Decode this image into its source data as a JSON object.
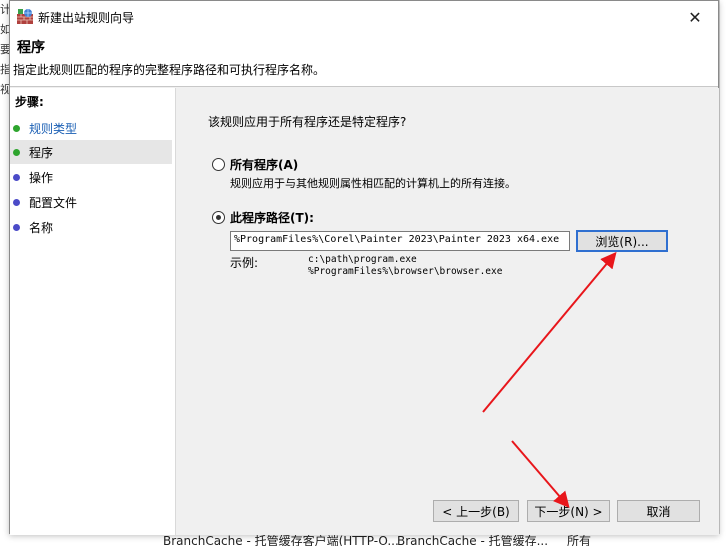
{
  "background": {
    "left_fragments": [
      "计",
      "如",
      "要",
      "指",
      "视"
    ],
    "right_fragments": [
      "",
      "",
      "",
      "",
      ""
    ],
    "bottom_row": [
      "BranchCache - 托管缓存客户端(HTTP-O...",
      "BranchCache - 托管缓存...",
      "所有"
    ]
  },
  "window": {
    "title": "新建出站规则向导",
    "close_glyph": "✕"
  },
  "header": {
    "title": "程序",
    "subtitle": "指定此规则匹配的程序的完整程序路径和可执行程序名称。"
  },
  "steps": {
    "title": "步骤:",
    "items": [
      {
        "label": "规则类型",
        "state": "done"
      },
      {
        "label": "程序",
        "state": "current"
      },
      {
        "label": "操作",
        "state": "todo"
      },
      {
        "label": "配置文件",
        "state": "todo"
      },
      {
        "label": "名称",
        "state": "todo"
      }
    ]
  },
  "content": {
    "question": "该规则应用于所有程序还是特定程序?",
    "option_all": {
      "label": "所有程序(A)",
      "description": "规则应用于与其他规则属性相匹配的计算机上的所有连接。",
      "checked": false
    },
    "option_path": {
      "label": "此程序路径(T):",
      "checked": true
    },
    "path_value": "%ProgramFiles%\\Corel\\Painter 2023\\Painter 2023 x64.exe",
    "browse_label": "浏览(R)...",
    "example_label": "示例:",
    "example_lines": [
      "c:\\path\\program.exe",
      "%ProgramFiles%\\browser\\browser.exe"
    ]
  },
  "footer": {
    "prev_label": "< 上一步(B)",
    "next_label": "下一步(N) >",
    "cancel_label": "取消"
  },
  "colors": {
    "step_done": "#2ea52e",
    "step_todo": "#4b4bc8",
    "link": "#1a5fb4",
    "focus_border": "#2f6fd0",
    "annotation_arrow": "#e8161b"
  }
}
